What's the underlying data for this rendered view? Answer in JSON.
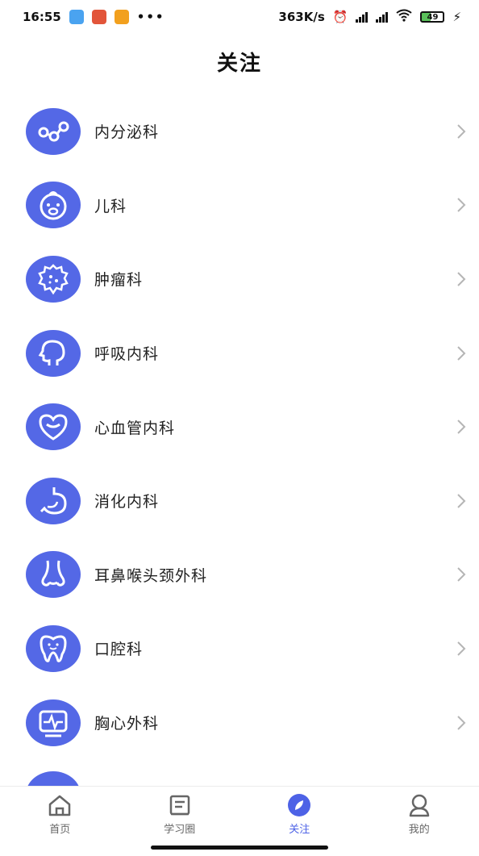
{
  "status_bar": {
    "time": "16:55",
    "network_speed": "363K/s",
    "battery": "49"
  },
  "title": "关注",
  "departments": [
    {
      "label": "内分泌科",
      "icon": "molecule-icon"
    },
    {
      "label": "儿科",
      "icon": "baby-face-icon"
    },
    {
      "label": "肿瘤科",
      "icon": "tumor-cell-icon"
    },
    {
      "label": "呼吸内科",
      "icon": "head-profile-icon"
    },
    {
      "label": "心血管内科",
      "icon": "heart-icon"
    },
    {
      "label": "消化内科",
      "icon": "stomach-icon"
    },
    {
      "label": "耳鼻喉头颈外科",
      "icon": "nose-icon"
    },
    {
      "label": "口腔科",
      "icon": "tooth-icon"
    },
    {
      "label": "胸心外科",
      "icon": "heart-monitor-icon"
    }
  ],
  "tabs": [
    {
      "label": "首页",
      "icon": "home-icon",
      "active": false
    },
    {
      "label": "学习圈",
      "icon": "document-icon",
      "active": false
    },
    {
      "label": "关注",
      "icon": "compass-icon",
      "active": true
    },
    {
      "label": "我的",
      "icon": "user-icon",
      "active": false
    }
  ],
  "colors": {
    "accent": "#5468e6",
    "tab_active": "#4d62e6"
  }
}
